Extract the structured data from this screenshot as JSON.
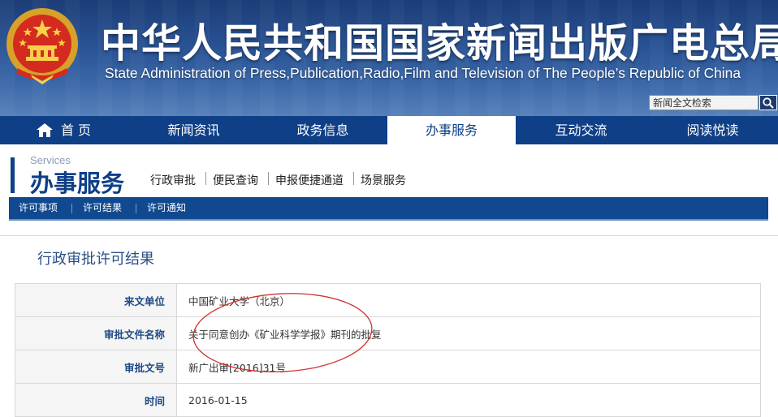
{
  "header": {
    "title_cn": "中华人民共和国国家新闻出版广电总局",
    "title_en": "State Administration of Press,Publication,Radio,Film and Television of The People’s Republic of China",
    "search_value": "新闻全文检索",
    "emblem_icon": "national-emblem-icon",
    "search_icon": "magnifier-icon"
  },
  "nav": {
    "items": [
      {
        "label": "首  页"
      },
      {
        "label": "新闻资讯"
      },
      {
        "label": "政务信息"
      },
      {
        "label": "办事服务"
      },
      {
        "label": "互动交流"
      },
      {
        "label": "阅读悦读"
      }
    ],
    "active_index": 3
  },
  "section": {
    "title_en": "Services",
    "title_cn": "办事服务",
    "sublinks": [
      "行政审批",
      "便民查询",
      "申报便捷通道",
      "场景服务"
    ]
  },
  "subnav": {
    "items": [
      "许可事项",
      "许可结果",
      "许可通知"
    ]
  },
  "page_title": "行政审批许可结果",
  "table": {
    "rows": [
      {
        "label": "来文单位",
        "value": "中国矿业大学（北京）"
      },
      {
        "label": "审批文件名称",
        "value": "关于同意创办《矿业科学学报》期刊的批复"
      },
      {
        "label": "审批文号",
        "value": "新广出审[2016]31号"
      },
      {
        "label": "时间",
        "value": "2016-01-15"
      }
    ]
  },
  "colors": {
    "nav_blue": "#0e3f87",
    "header_blue": "#2a5597",
    "label_blue": "#1f4a85",
    "annotation_red": "#d0312d"
  }
}
